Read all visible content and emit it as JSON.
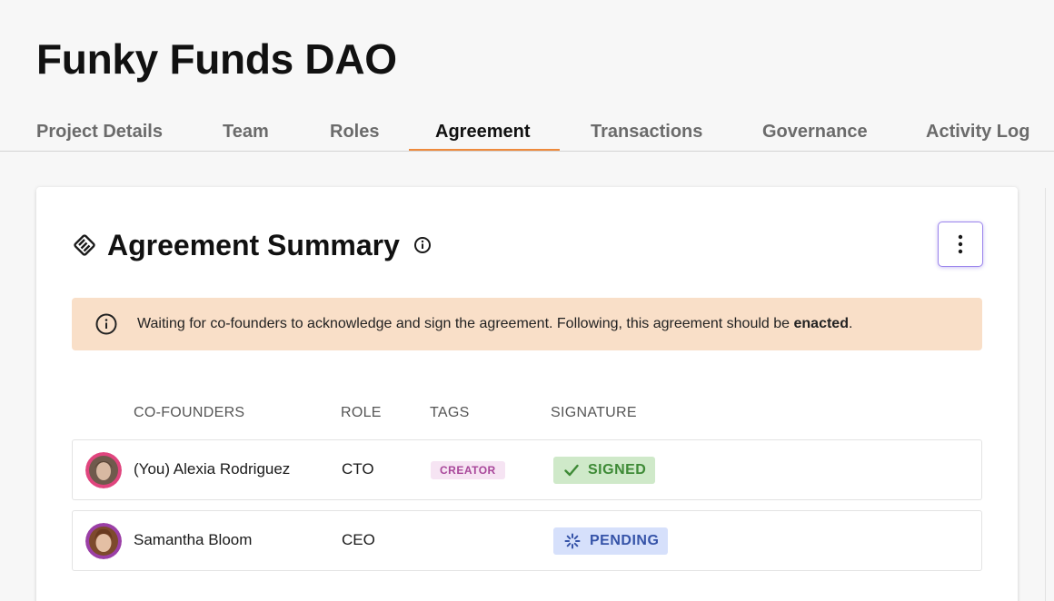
{
  "page": {
    "title": "Funky Funds DAO"
  },
  "tabs": [
    {
      "label": "Project Details",
      "active": false
    },
    {
      "label": "Team",
      "active": false
    },
    {
      "label": "Roles",
      "active": false
    },
    {
      "label": "Agreement",
      "active": true
    },
    {
      "label": "Transactions",
      "active": false
    },
    {
      "label": "Governance",
      "active": false
    },
    {
      "label": "Activity Log",
      "active": false
    }
  ],
  "card": {
    "title": "Agreement Summary",
    "title_icon": "handshake-icon",
    "info_icon": "info-icon",
    "menu_icon": "more-vertical-icon"
  },
  "alert": {
    "icon": "info-icon",
    "text_before": "Waiting for co-founders to acknowledge and sign the agreement. Following, this agreement should be ",
    "text_bold": "enacted",
    "text_after": "."
  },
  "table": {
    "headers": {
      "cofounders": "CO-FOUNDERS",
      "role": "ROLE",
      "tags": "TAGS",
      "signature": "SIGNATURE"
    },
    "rows": [
      {
        "name": "(You) Alexia Rodriguez",
        "role": "CTO",
        "tag": "CREATOR",
        "signature": "SIGNED",
        "signature_icon": "check-icon"
      },
      {
        "name": "Samantha Bloom",
        "role": "CEO",
        "tag": "",
        "signature": "PENDING",
        "signature_icon": "spinner-icon"
      }
    ]
  },
  "colors": {
    "accent_tab": "#ee8a3c",
    "alert_bg": "#f9dfc8",
    "signed_bg": "#cfe9c9",
    "signed_text": "#3e8a36",
    "pending_bg": "#d6e0fb",
    "pending_text": "#3553a8",
    "creator_bg": "#f6e4f3",
    "creator_text": "#a8479a",
    "menu_border": "#9b85ec"
  }
}
